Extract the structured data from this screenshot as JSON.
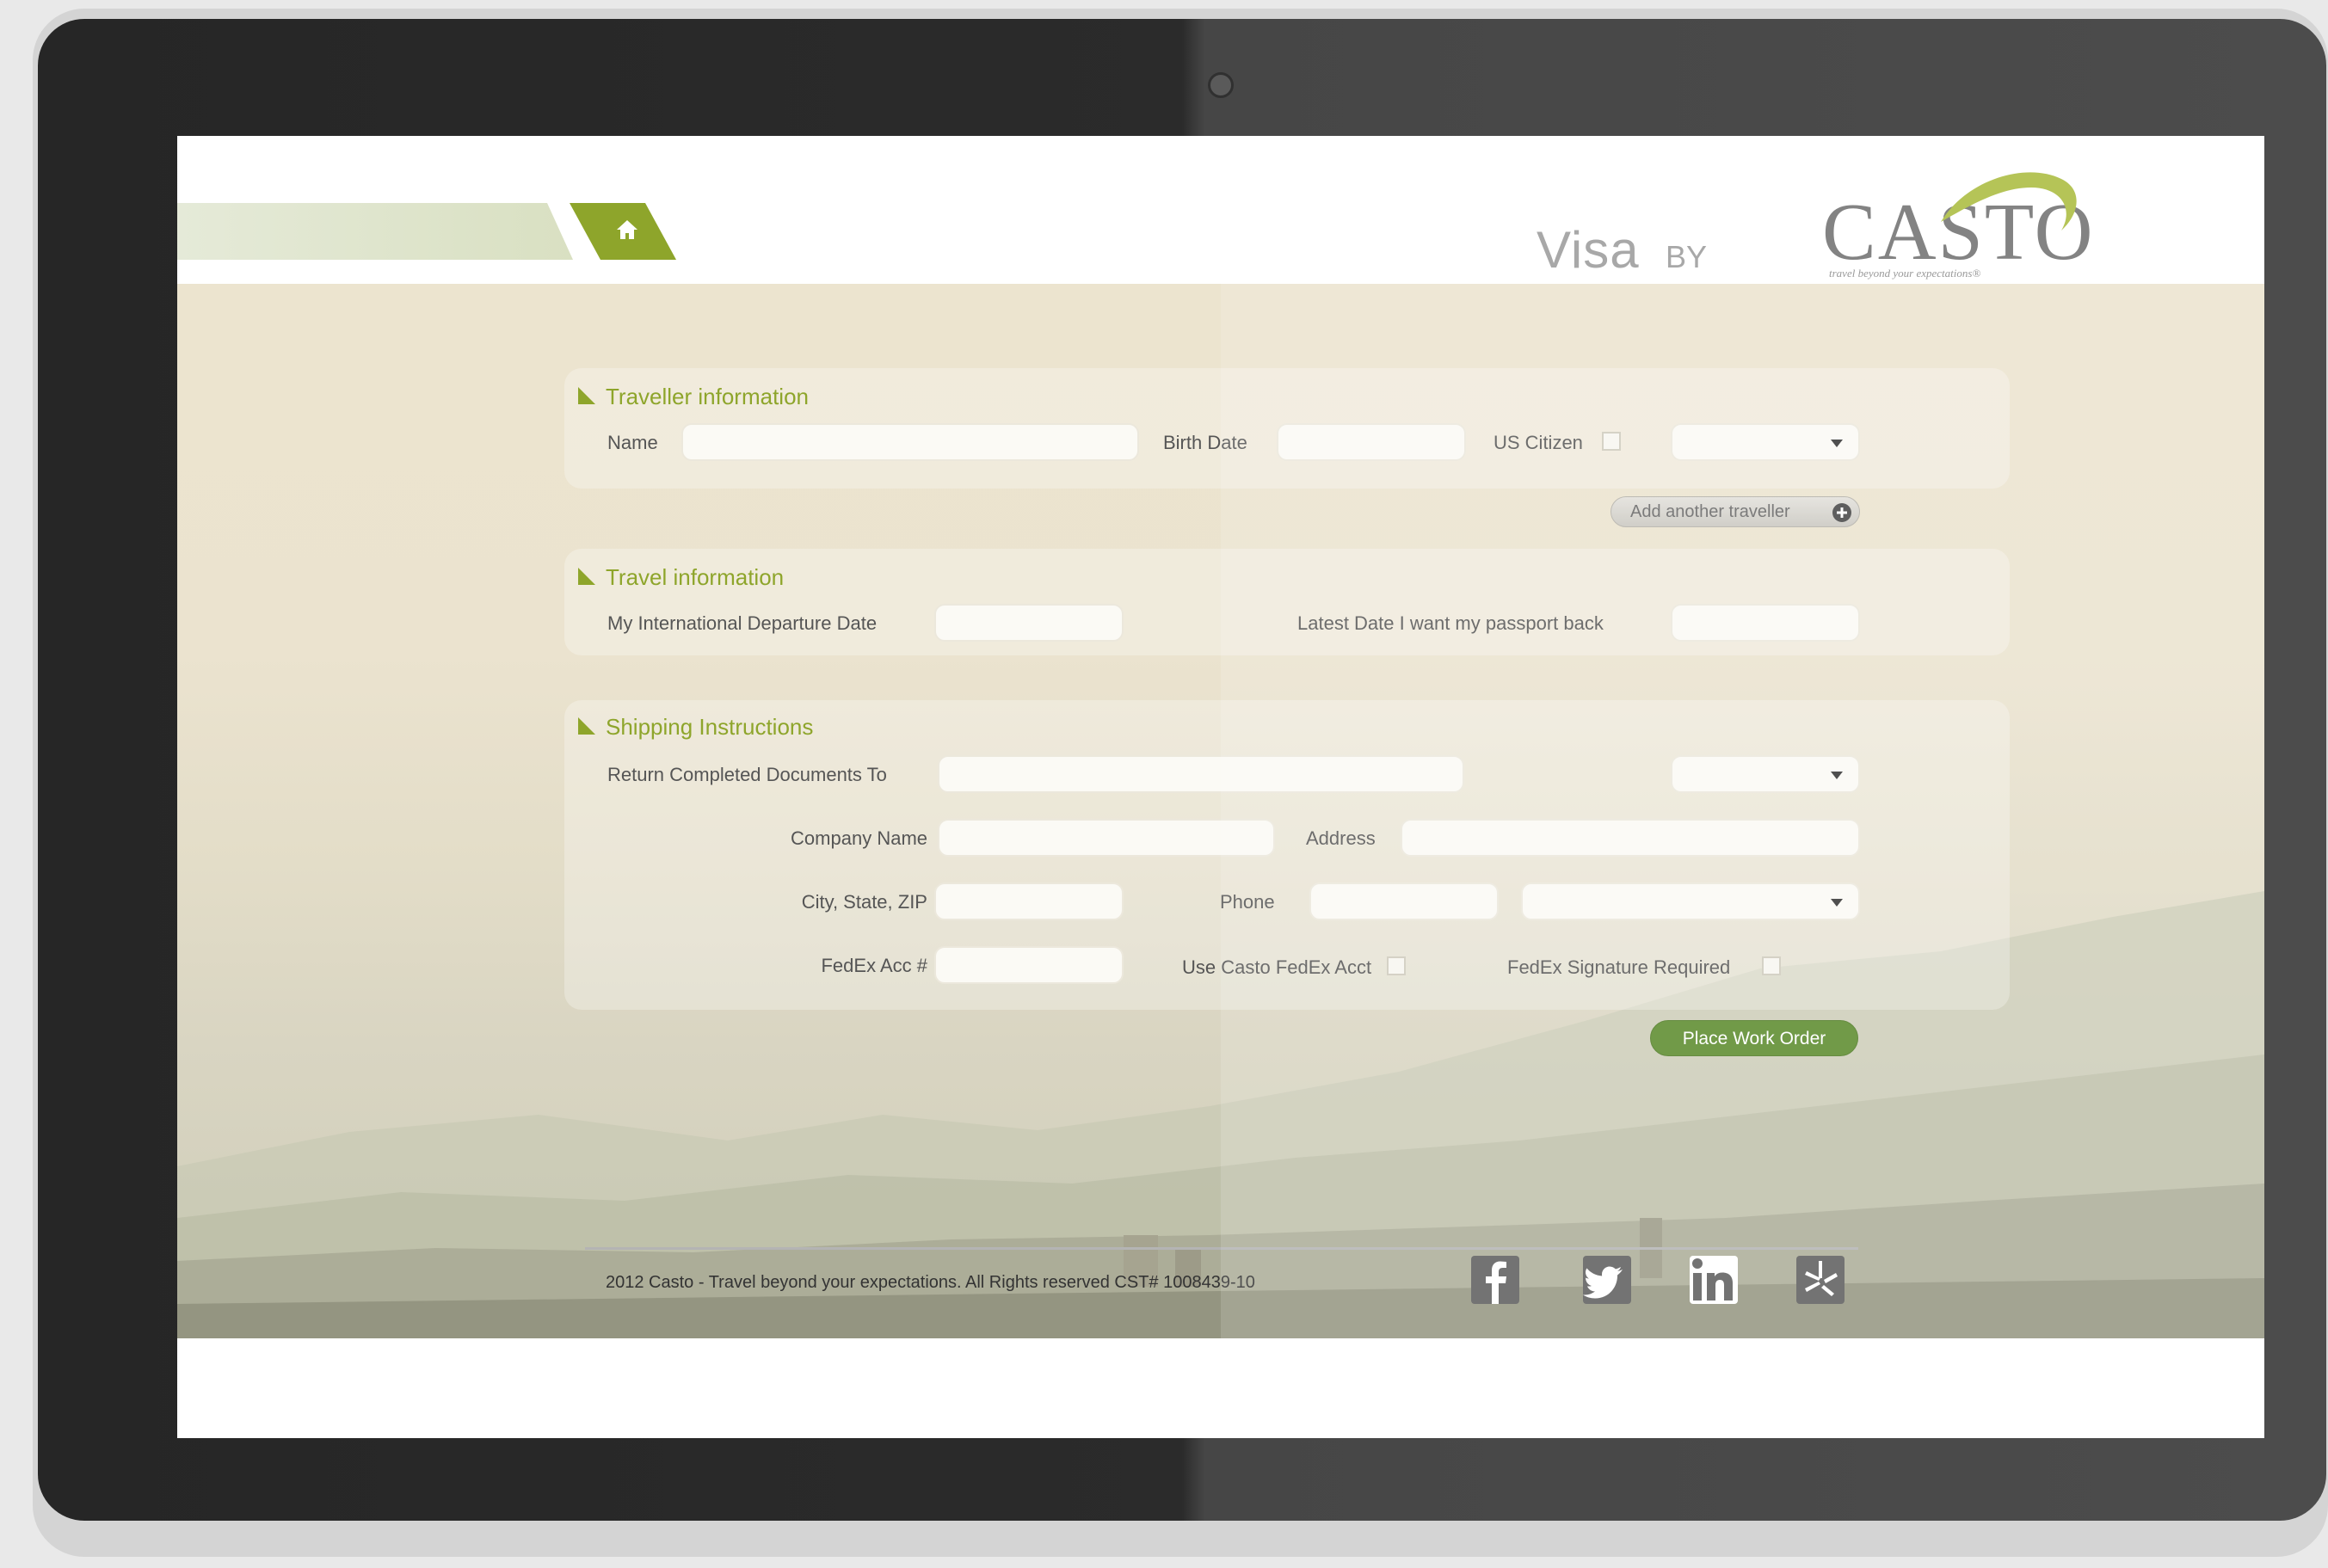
{
  "header": {
    "logo_visa": "Visa",
    "logo_by": "BY",
    "logo_casto": "CASTO",
    "logo_tagline": "travel beyond your expectations®"
  },
  "traveller": {
    "title": "Traveller information",
    "name_label": "Name",
    "birth_date_label": "Birth Date",
    "us_citizen_label": "US Citizen",
    "add_traveller_label": "Add another traveller"
  },
  "travel": {
    "title": "Travel information",
    "departure_label": "My International Departure Date",
    "passport_back_label": "Latest Date I want my passport back"
  },
  "shipping": {
    "title": "Shipping Instructions",
    "return_label": "Return Completed Documents To",
    "company_label": "Company Name",
    "address_label": "Address",
    "city_label": "City, State, ZIP",
    "phone_label": "Phone",
    "fedex_acc_label": "FedEx Acc #",
    "use_casto_fedex_label": "Use Casto FedEx Acct",
    "signature_label": "FedEx Signature Required"
  },
  "actions": {
    "place_order_label": "Place Work Order"
  },
  "footer": {
    "copyright": "2012 Casto - Travel beyond your expectations. All Rights reserved CST# 1008439-10",
    "social_icons": [
      "facebook-icon",
      "twitter-icon",
      "linkedin-icon",
      "yelp-icon"
    ]
  },
  "colors": {
    "accent_green": "#8ea52b",
    "button_green": "#5a8a2a",
    "bezel": "#2b2b2b"
  }
}
